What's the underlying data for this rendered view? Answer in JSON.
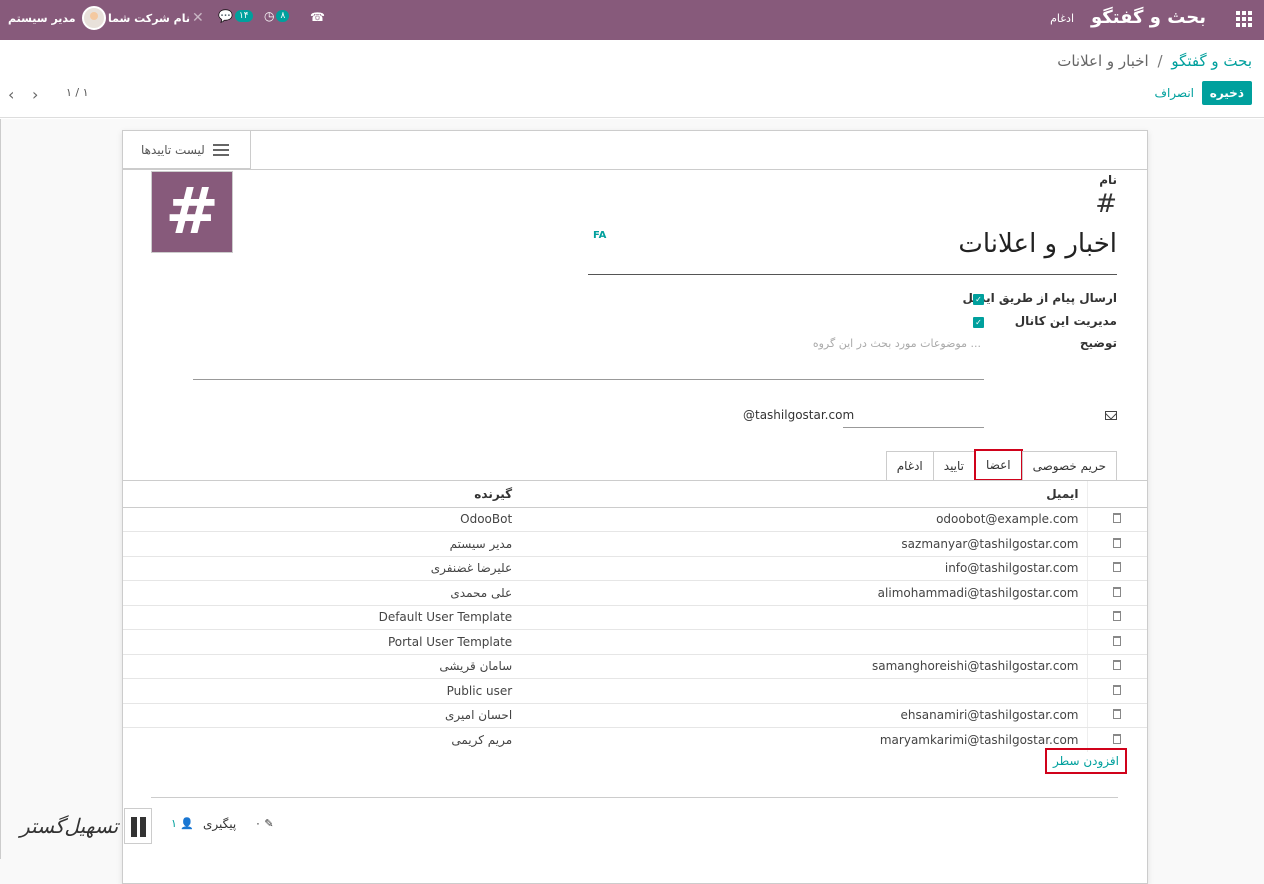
{
  "topbar": {
    "app_title": "بحث و گفتگو",
    "menu_merge": "ادغام",
    "user_name": "مدیر سیستم",
    "company": "نام شرکت شما",
    "chat_count": "۱۴",
    "activity_count": "۸",
    "icons": [
      "apps-icon",
      "phone-icon",
      "clock-icon",
      "chat-icon",
      "close-icon"
    ]
  },
  "control": {
    "breadcrumb_parent": "بحث و گفتگو",
    "breadcrumb_sep": "/",
    "breadcrumb_current": "اخبار و اعلانات",
    "save": "ذخیره",
    "discard": "انصراف",
    "pager": "۱ / ۱"
  },
  "sheet": {
    "approvals_button": "لیست تاییدها",
    "name_label": "نام",
    "hash": "#",
    "name_value": "اخبار و اعلانات",
    "lang_tag": "FA",
    "email_send_label": "ارسال پیام از طریق ایمیل",
    "manage_channel_label": "مدیریت این کانال",
    "description_label": "توضیح",
    "description_placeholder": "موضوعات مورد بحث در این گروه ...",
    "alias_value": "@tashilgostar.com"
  },
  "tabs": [
    "حریم خصوصی",
    "اعضا",
    "تایید",
    "ادغام"
  ],
  "members": {
    "headers": {
      "recipient": "گیرنده",
      "email": "ایمیل"
    },
    "rows": [
      {
        "name": "OdooBot",
        "email": "odoobot@example.com"
      },
      {
        "name": "مدیر سیستم",
        "email": "sazmanyar@tashilgostar.com"
      },
      {
        "name": "علیرضا غضنفری",
        "email": "info@tashilgostar.com"
      },
      {
        "name": "علی محمدی",
        "email": "alimohammadi@tashilgostar.com"
      },
      {
        "name": "Default User Template",
        "email": ""
      },
      {
        "name": "Portal User Template",
        "email": ""
      },
      {
        "name": "سامان قریشی",
        "email": "samanghoreishi@tashilgostar.com"
      },
      {
        "name": "Public user",
        "email": ""
      },
      {
        "name": "احسان امیری",
        "email": "ehsanamiri@tashilgostar.com"
      },
      {
        "name": "مریم کریمی",
        "email": "maryamkarimi@tashilgostar.com"
      }
    ],
    "add_line": "افزودن سطر"
  },
  "chatter": {
    "follow": "پیگیری",
    "followers": "۱",
    "attachments": "۰"
  },
  "watermark": "تسهیل‌گستر",
  "colors": {
    "brand": "#875a7b",
    "accent": "#00a09d",
    "highlight": "#d0021b"
  }
}
